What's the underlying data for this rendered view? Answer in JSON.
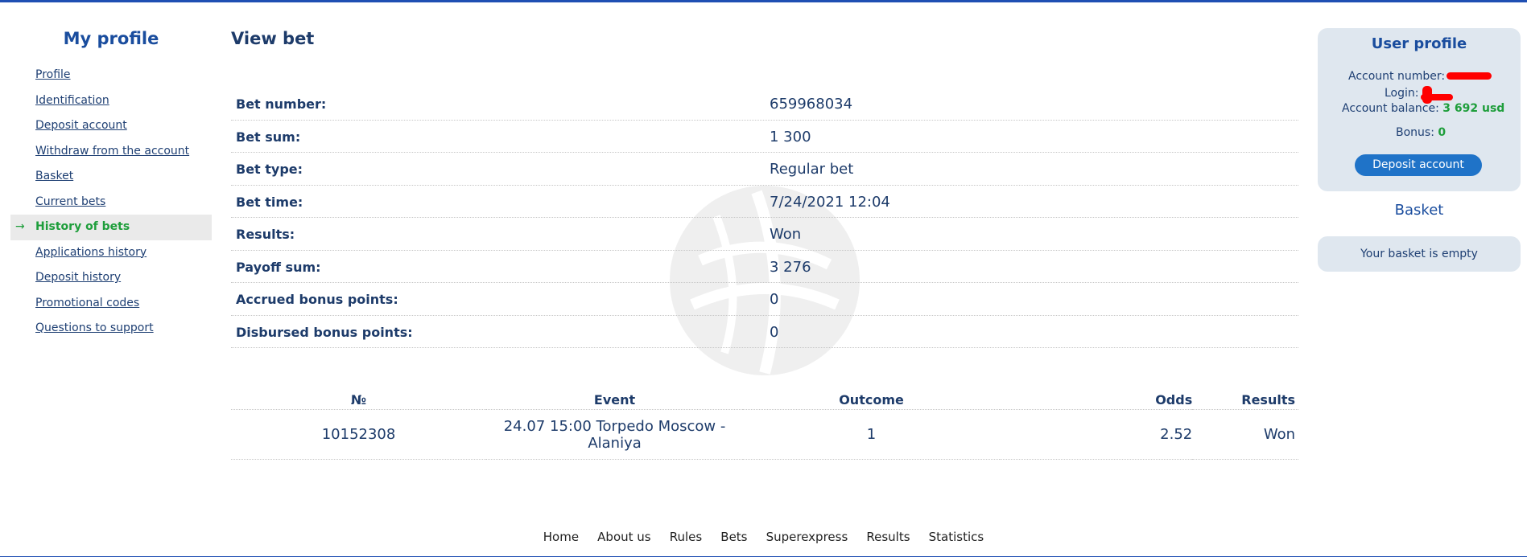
{
  "sidebar": {
    "title": "My profile",
    "active_arrow": "→",
    "items": [
      {
        "label": "Profile"
      },
      {
        "label": "Identification"
      },
      {
        "label": "Deposit account"
      },
      {
        "label": "Withdraw from the account"
      },
      {
        "label": "Basket"
      },
      {
        "label": "Current bets"
      },
      {
        "label": "History of bets"
      },
      {
        "label": "Applications history"
      },
      {
        "label": "Deposit history"
      },
      {
        "label": "Promotional codes"
      },
      {
        "label": "Questions to support"
      }
    ]
  },
  "main": {
    "title": "View bet",
    "details": [
      {
        "label": "Bet number:",
        "value": "659968034"
      },
      {
        "label": "Bet sum:",
        "value": "1 300"
      },
      {
        "label": "Bet type:",
        "value": "Regular bet"
      },
      {
        "label": "Bet time:",
        "value": "7/24/2021 12:04"
      },
      {
        "label": "Results:",
        "value": "Won"
      },
      {
        "label": "Payoff sum:",
        "value": "3 276"
      },
      {
        "label": "Accrued bonus points:",
        "value": "0"
      },
      {
        "label": "Disbursed bonus points:",
        "value": "0"
      }
    ],
    "events_table": {
      "headers": {
        "no": "№",
        "event": "Event",
        "outcome": "Outcome",
        "odds": "Odds",
        "results": "Results"
      },
      "rows": [
        {
          "no": "10152308",
          "event": "24.07 15:00 Torpedo Moscow - Alaniya",
          "outcome": "1",
          "odds": "2.52",
          "results": "Won"
        }
      ]
    }
  },
  "user_profile": {
    "title": "User profile",
    "account_number_label": "Account number:",
    "login_label": "Login:",
    "balance_label": "Account balance:",
    "balance_value": "3 692 usd",
    "bonus_label": "Bonus:",
    "bonus_value": "0",
    "deposit_button": "Deposit account"
  },
  "basket": {
    "title": "Basket",
    "empty_text": "Your basket is empty"
  },
  "footer": {
    "links": [
      "Home",
      "About us",
      "Rules",
      "Bets",
      "Superexpress",
      "Results",
      "Statistics"
    ]
  },
  "colors": {
    "accent_blue": "#1a4d9e",
    "active_green": "#1e9e3b",
    "button_blue": "#1f73c8",
    "panel_bg": "#dfe7ef",
    "redaction": "#ff0000"
  }
}
